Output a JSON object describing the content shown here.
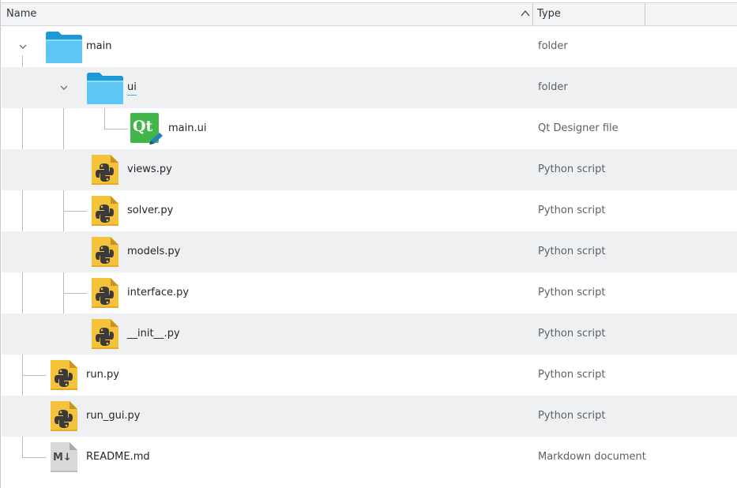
{
  "header": {
    "name_label": "Name",
    "type_label": "Type",
    "sort_icon": "chevron-up-icon"
  },
  "rows": [
    {
      "name": "main",
      "type": "folder",
      "icon": "folder-icon",
      "expander": "chevron-down-icon"
    },
    {
      "name": "ui",
      "type": "folder",
      "icon": "folder-icon",
      "expander": "chevron-down-icon"
    },
    {
      "name": "main.ui",
      "type": "Qt Designer file",
      "icon": "qt-designer-icon"
    },
    {
      "name": "views.py",
      "type": "Python script",
      "icon": "python-icon"
    },
    {
      "name": "solver.py",
      "type": "Python script",
      "icon": "python-icon"
    },
    {
      "name": "models.py",
      "type": "Python script",
      "icon": "python-icon"
    },
    {
      "name": "interface.py",
      "type": "Python script",
      "icon": "python-icon"
    },
    {
      "name": "__init__.py",
      "type": "Python script",
      "icon": "python-icon"
    },
    {
      "name": "run.py",
      "type": "Python script",
      "icon": "python-icon"
    },
    {
      "name": "run_gui.py",
      "type": "Python script",
      "icon": "python-icon"
    },
    {
      "name": "README.md",
      "type": "Markdown document",
      "icon": "markdown-icon"
    }
  ],
  "icons": {
    "qt_label": "Qt",
    "markdown_label": "M↓"
  },
  "colors": {
    "folder": "#3daee9",
    "folder_light": "#5ec6f5",
    "python": "#f5c33b",
    "qt": "#41b649",
    "markdown": "#d9d9d9",
    "selection_accent": "#3daee9",
    "alt_row": "#eff0f1"
  }
}
